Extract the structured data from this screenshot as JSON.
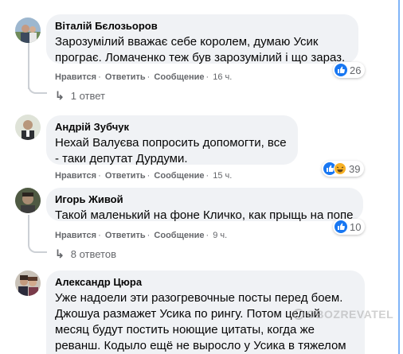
{
  "comments": [
    {
      "author": "Віталій Бєлозьоров",
      "text": "Зарозумілий вважає себе королем, думаю Усик програє. Ломаченко теж був зарозумілий і що зараз.",
      "like": "Нравится",
      "reply": "Ответить",
      "message": "Сообщение",
      "time": "16 ч.",
      "reactions": "26",
      "replies": "1 ответ"
    },
    {
      "author": "Андрій Зубчук",
      "text": "Нехай Валуєва попросить допомогти, все - таки депутат Дурдуми.",
      "like": "Нравится",
      "reply": "Ответить",
      "message": "Сообщение",
      "time": "15 ч.",
      "reactions": "39"
    },
    {
      "author": "Игорь Живой",
      "text": "Такой маленький на фоне Кличко, как прыщь на попе",
      "like": "Нравится",
      "reply": "Ответить",
      "message": "Сообщение",
      "time": "9 ч.",
      "reactions": "10",
      "replies": "8 ответов"
    },
    {
      "author": "Александр Цюра",
      "text": "Уже надоели эти разогревочные посты перед боем. Джошуа размажет Усика по рингу. Потом целый месяц будут постить ноющие цитаты, когда же реванш. Кодыло ещё не выросло у Усика в тяжелом"
    }
  ],
  "watermark": "OBOZREVATEL",
  "colors": {
    "like_blue": "#1877f2",
    "bubble": "#f0f2f5",
    "meta": "#65676b"
  }
}
